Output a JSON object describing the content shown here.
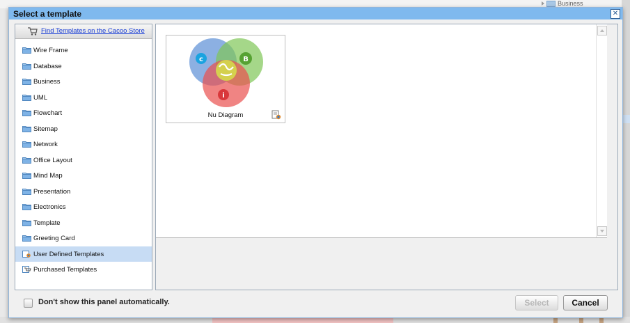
{
  "background": {
    "tree_item": "Business"
  },
  "dialog": {
    "title": "Select a template",
    "close_icon": "close-icon"
  },
  "sidebar": {
    "store_link": "Find Templates on the Cacoo Store",
    "items": [
      {
        "label": "Wire Frame",
        "icon": "folder-icon"
      },
      {
        "label": "Database",
        "icon": "folder-icon"
      },
      {
        "label": "Business",
        "icon": "folder-icon"
      },
      {
        "label": "UML",
        "icon": "folder-icon"
      },
      {
        "label": "Flowchart",
        "icon": "folder-icon"
      },
      {
        "label": "Sitemap",
        "icon": "folder-icon"
      },
      {
        "label": "Network",
        "icon": "folder-icon"
      },
      {
        "label": "Office Layout",
        "icon": "folder-icon"
      },
      {
        "label": "Mind Map",
        "icon": "folder-icon"
      },
      {
        "label": "Presentation",
        "icon": "folder-icon"
      },
      {
        "label": "Electronics",
        "icon": "folder-icon"
      },
      {
        "label": "Template",
        "icon": "folder-icon"
      },
      {
        "label": "Greeting Card",
        "icon": "folder-icon"
      },
      {
        "label": "User Defined Templates",
        "icon": "user-template-icon",
        "selected": true
      },
      {
        "label": "Purchased Templates",
        "icon": "cart-icon"
      }
    ]
  },
  "gallery": {
    "templates": [
      {
        "name": "Nu Diagram",
        "badge": "user-defined-badge-icon"
      }
    ]
  },
  "footer": {
    "checkbox_label": "Don't show this panel automatically.",
    "select_label": "Select",
    "cancel_label": "Cancel"
  },
  "colors": {
    "titlebar": "#7fb9ee",
    "selection": "#c7dcf4",
    "link": "#1a3fd6",
    "venn_blue": "#5b8fd6",
    "venn_green": "#7fc657",
    "venn_red": "#e9504f"
  }
}
